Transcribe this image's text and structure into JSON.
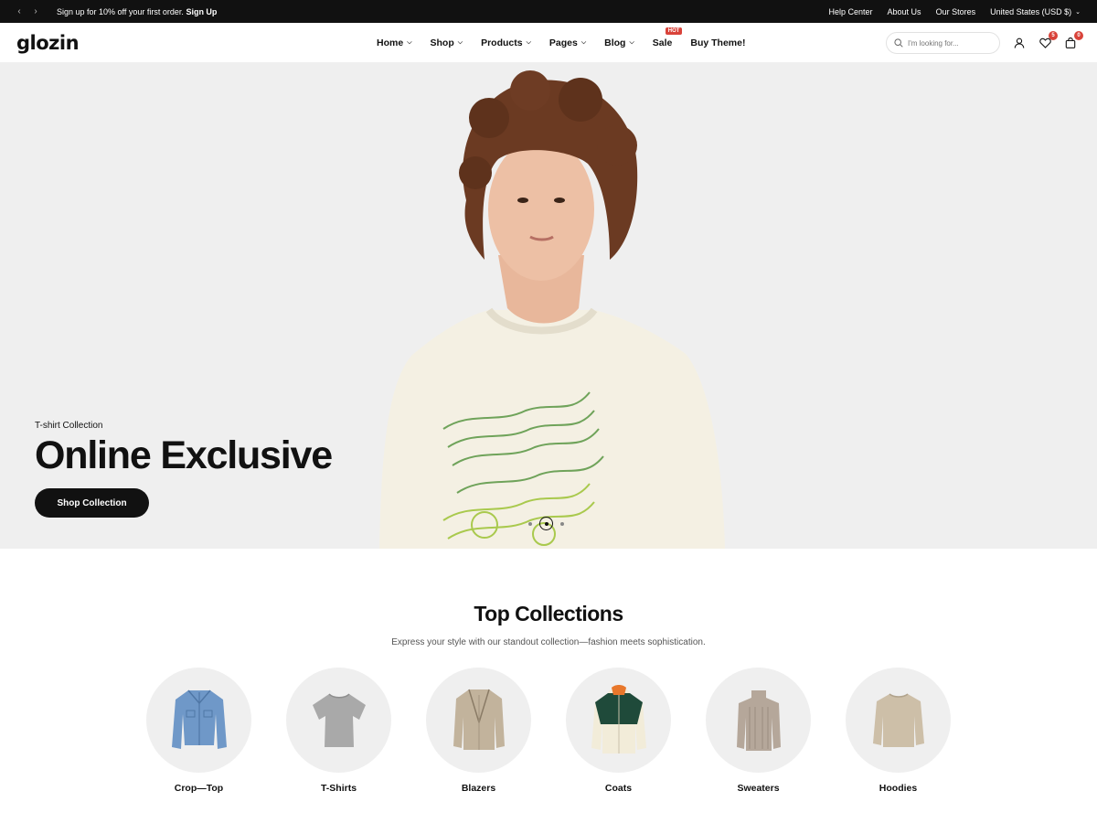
{
  "topbar": {
    "promo_text": "Sign up for 10% off your first order.",
    "promo_link": "Sign Up",
    "links": [
      "Help Center",
      "About Us",
      "Our Stores"
    ],
    "currency": "United States (USD $)"
  },
  "header": {
    "logo": "glozin",
    "nav": [
      {
        "label": "Home",
        "dropdown": true
      },
      {
        "label": "Shop",
        "dropdown": true
      },
      {
        "label": "Products",
        "dropdown": true
      },
      {
        "label": "Pages",
        "dropdown": true
      },
      {
        "label": "Blog",
        "dropdown": true
      },
      {
        "label": "Sale",
        "dropdown": false,
        "badge": "HOT"
      },
      {
        "label": "Buy Theme!",
        "dropdown": false
      }
    ],
    "search_placeholder": "I'm looking for...",
    "wishlist_count": "5",
    "cart_count": "0"
  },
  "hero": {
    "subtitle": "T-shirt Collection",
    "title": "Online Exclusive",
    "button": "Shop Collection",
    "slides": 3,
    "active_slide": 2
  },
  "collections": {
    "title": "Top Collections",
    "subtitle": "Express your style with our standout collection—fashion meets sophistication.",
    "items": [
      {
        "label": "Crop—Top",
        "icon": "denim-jacket-icon",
        "color": "#6f98c8"
      },
      {
        "label": "T-Shirts",
        "icon": "tshirt-icon",
        "color": "#a9a9a9"
      },
      {
        "label": "Blazers",
        "icon": "blazer-icon",
        "color": "#c2b39c"
      },
      {
        "label": "Coats",
        "icon": "coat-icon",
        "color": "#1f4a3a"
      },
      {
        "label": "Sweaters",
        "icon": "sweater-icon",
        "color": "#b5a79a"
      },
      {
        "label": "Hoodies",
        "icon": "hoodie-icon",
        "color": "#cdbfa8"
      }
    ]
  }
}
